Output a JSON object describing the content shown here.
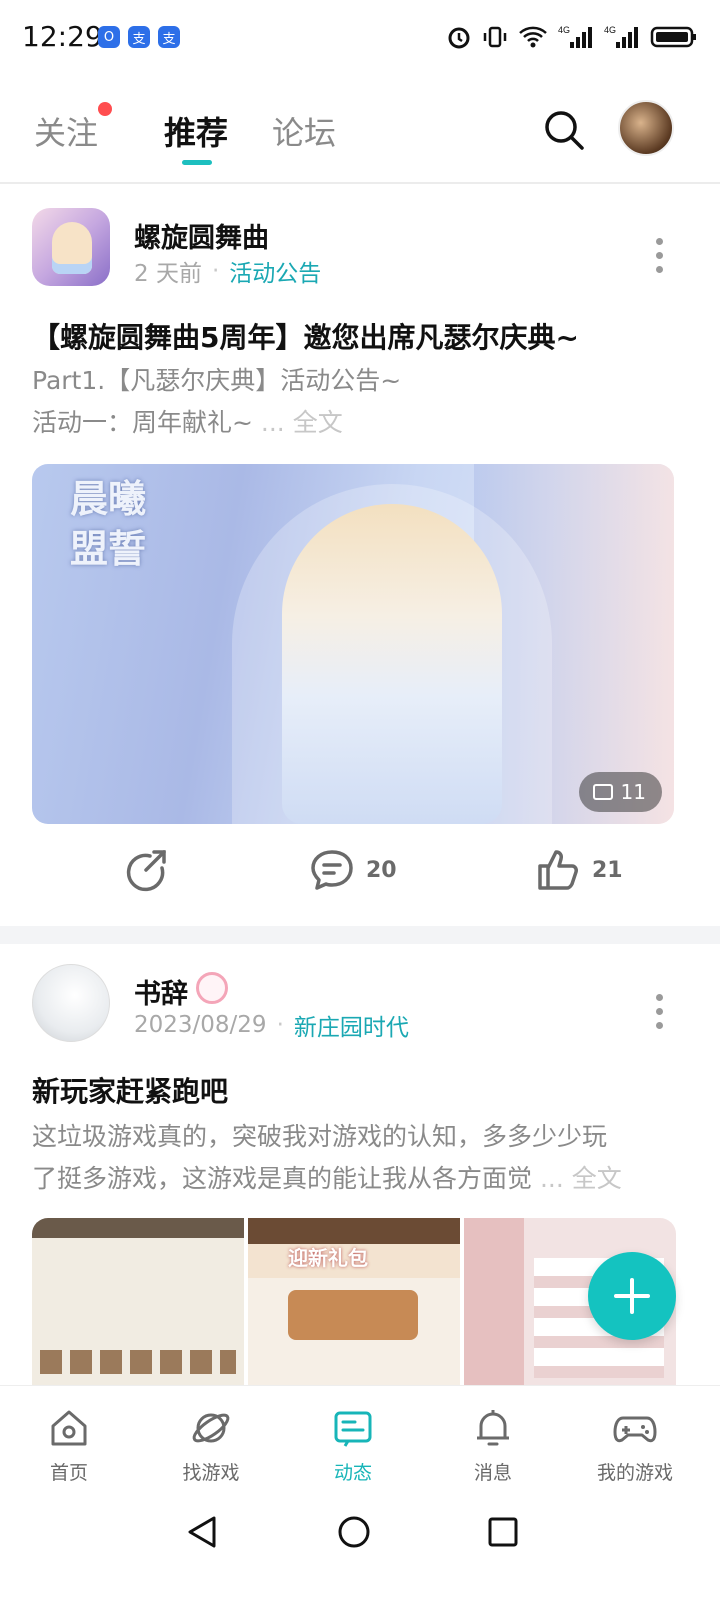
{
  "status_bar": {
    "time": "12:29",
    "app_icons": [
      "O",
      "支",
      "支"
    ],
    "net1": "4G",
    "net2": "4G"
  },
  "tabs": [
    {
      "label": "关注",
      "has_dot": true
    },
    {
      "label": "推荐",
      "active": true
    },
    {
      "label": "论坛"
    }
  ],
  "posts": [
    {
      "author": "螺旋圆舞曲",
      "time": "2 天前",
      "tag": "活动公告",
      "title": "【螺旋圆舞曲5周年】邀您出席凡瑟尔庆典~",
      "excerpt_line1": "Part1.【凡瑟尔庆典】活动公告~",
      "excerpt_line2": "活动一：周年献礼~",
      "more_text": "... 全文",
      "image_calligraphy": "晨曦盟誓",
      "image_count": "11",
      "comments": "20",
      "likes": "21"
    },
    {
      "author": "书辞",
      "time": "2023/08/29",
      "tag": "新庄园时代",
      "title": "新玩家赶紧跑吧",
      "excerpt_line1": "这垃圾游戏真的，突破我对游戏的认知，多多少少玩",
      "excerpt_line2": "了挺多游戏，这游戏是真的能让我从各方面觉",
      "more_text": "... 全文"
    }
  ],
  "bottom_nav": [
    {
      "label": "首页",
      "icon": "home-icon"
    },
    {
      "label": "找游戏",
      "icon": "planet-icon"
    },
    {
      "label": "动态",
      "icon": "feed-icon",
      "active": true
    },
    {
      "label": "消息",
      "icon": "bell-icon"
    },
    {
      "label": "我的游戏",
      "icon": "gamepad-icon"
    }
  ],
  "colors": {
    "accent": "#1dbfbf",
    "tag": "#1aa8b3",
    "dot": "#ff4d4f"
  }
}
